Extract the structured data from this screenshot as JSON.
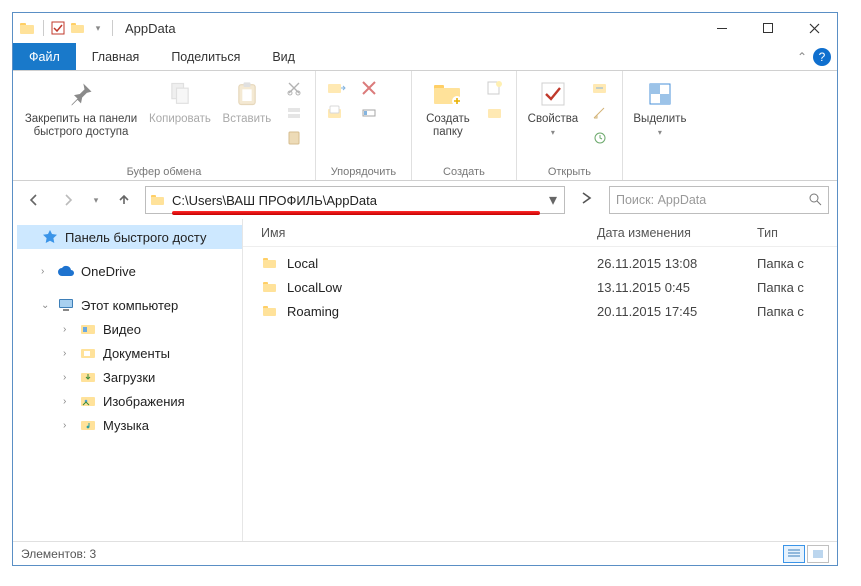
{
  "window": {
    "title": "AppData"
  },
  "tabs": {
    "file": "Файл",
    "home": "Главная",
    "share": "Поделиться",
    "view": "Вид"
  },
  "ribbon": {
    "pin": "Закрепить на панели\nбыстрого доступа",
    "copy": "Копировать",
    "paste": "Вставить",
    "clipboard_group": "Буфер обмена",
    "organize_group": "Упорядочить",
    "new_folder": "Создать\nпапку",
    "new_group": "Создать",
    "properties": "Свойства",
    "open_group": "Открыть",
    "select": "Выделить"
  },
  "address": {
    "path": "C:\\Users\\ВАШ ПРОФИЛЬ\\AppData"
  },
  "search": {
    "placeholder": "Поиск: AppData"
  },
  "navpane": {
    "quick": "Панель быстрого досту",
    "onedrive": "OneDrive",
    "thispc": "Этот компьютер",
    "video": "Видео",
    "documents": "Документы",
    "downloads": "Загрузки",
    "pictures": "Изображения",
    "music": "Музыка"
  },
  "columns": {
    "name": "Имя",
    "date": "Дата изменения",
    "type": "Тип"
  },
  "rows": [
    {
      "name": "Local",
      "date": "26.11.2015 13:08",
      "type": "Папка с"
    },
    {
      "name": "LocalLow",
      "date": "13.11.2015 0:45",
      "type": "Папка с"
    },
    {
      "name": "Roaming",
      "date": "20.11.2015 17:45",
      "type": "Папка с"
    }
  ],
  "status": {
    "count": "Элементов: 3"
  }
}
